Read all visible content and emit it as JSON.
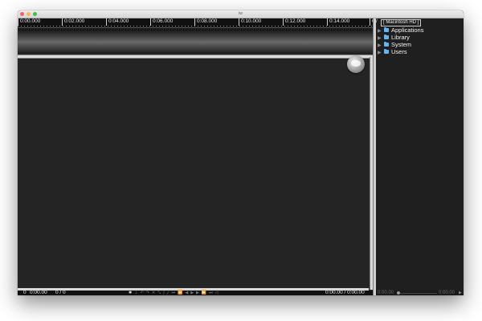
{
  "window": {
    "title": "iw"
  },
  "ruler": {
    "ticks": [
      "0:00.000",
      "0:02.000",
      "0:04.000",
      "0:06.000",
      "0:08.000",
      "0:10.000",
      "0:12.000",
      "0:14.000",
      "0:"
    ]
  },
  "statusbar": {
    "frame": "0",
    "time": "0:00.00",
    "count": "0 / 0",
    "position": "0:00.00  /  0:00.00",
    "tools": [
      "gear-icon",
      "anchor-icon",
      "undo-icon",
      "redo-icon",
      "cut-icon",
      "merge-icon",
      "split-icon",
      "pen-icon",
      "begin-icon",
      "rewind-icon",
      "step-back-icon",
      "play-icon",
      "step-forward-icon",
      "fast-forward-icon",
      "end-icon",
      "volume-icon"
    ]
  },
  "browser": {
    "path_prefix": "/",
    "path_item": "[ Macintosh HD ]",
    "items": [
      {
        "label": "Applications"
      },
      {
        "label": "Library"
      },
      {
        "label": "System"
      },
      {
        "label": "Users"
      }
    ]
  },
  "player": {
    "left_time": "0:00.00",
    "right_time": "0:00.00"
  },
  "colors": {
    "folder": "#63b4f0",
    "background": "#242424"
  }
}
